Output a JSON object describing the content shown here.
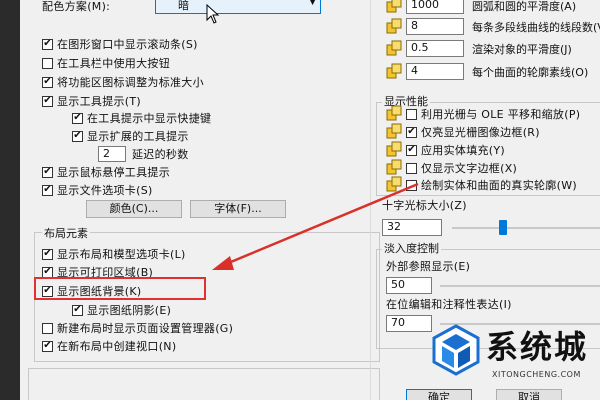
{
  "left_top": {
    "color_scheme_label": "配色方案(M):",
    "color_scheme_value": "暗"
  },
  "window_options": {
    "items": [
      {
        "label": "在图形窗口中显示滚动条(S)",
        "checked": true
      },
      {
        "label": "在工具栏中使用大按钮",
        "checked": false
      },
      {
        "label": "将功能区图标调整为标准大小",
        "checked": true
      },
      {
        "label": "显示工具提示(T)",
        "checked": true
      },
      {
        "label": "在工具提示中显示快捷键",
        "checked": true
      },
      {
        "label": "显示扩展的工具提示",
        "checked": true
      }
    ],
    "delay_value": "2",
    "delay_label": "延迟的秒数",
    "more_items": [
      {
        "label": "显示鼠标悬停工具提示",
        "checked": true
      },
      {
        "label": "显示文件选项卡(S)",
        "checked": true
      }
    ],
    "colors_button": "颜色(C)...",
    "fonts_button": "字体(F)..."
  },
  "layout_elements": {
    "title": "布局元素",
    "items": [
      {
        "label": "显示布局和模型选项卡(L)",
        "checked": true
      },
      {
        "label": "显示可打印区域(B)",
        "checked": true
      },
      {
        "label": "显示图纸背景(K)",
        "checked": true
      },
      {
        "label": "显示图纸阴影(E)",
        "checked": true
      },
      {
        "label": "新建布局时显示页面设置管理器(G)",
        "checked": false
      },
      {
        "label": "在新布局中创建视口(N)",
        "checked": true
      }
    ]
  },
  "display_resolution": {
    "items": [
      {
        "value": "1000",
        "label": "圆弧和圆的平滑度(A)"
      },
      {
        "value": "8",
        "label": "每条多段线曲线的线段数(V)"
      },
      {
        "value": "0.5",
        "label": "渲染对象的平滑度(J)"
      },
      {
        "value": "4",
        "label": "每个曲面的轮廓素线(O)"
      }
    ]
  },
  "display_performance": {
    "title": "显示性能",
    "items": [
      {
        "label": "利用光栅与 OLE 平移和缩放(P)",
        "checked": false
      },
      {
        "label": "仅亮显光栅图像边框(R)",
        "checked": true
      },
      {
        "label": "应用实体填充(Y)",
        "checked": true
      },
      {
        "label": "仅显示文字边框(X)",
        "checked": false
      },
      {
        "label": "绘制实体和曲面的真实轮廓(W)",
        "checked": false
      }
    ]
  },
  "crosshair": {
    "title": "十字光标大小(Z)",
    "value": "32",
    "slider_fraction": 0.32
  },
  "fade_control": {
    "title": "淡入度控制",
    "xref_label": "外部参照显示(E)",
    "xref_value": "50",
    "inplace_label": "在位编辑和注释性表达(I)",
    "inplace_value": "70"
  },
  "footer": {
    "ok_button": "确定",
    "cancel_button": "取消"
  },
  "watermark": {
    "brand": "系统城",
    "site": "XITONGCHENG.COM"
  },
  "colors": {
    "highlight_box": "#e03030",
    "arrow": "#d9302a",
    "accent": "#0078d7"
  }
}
